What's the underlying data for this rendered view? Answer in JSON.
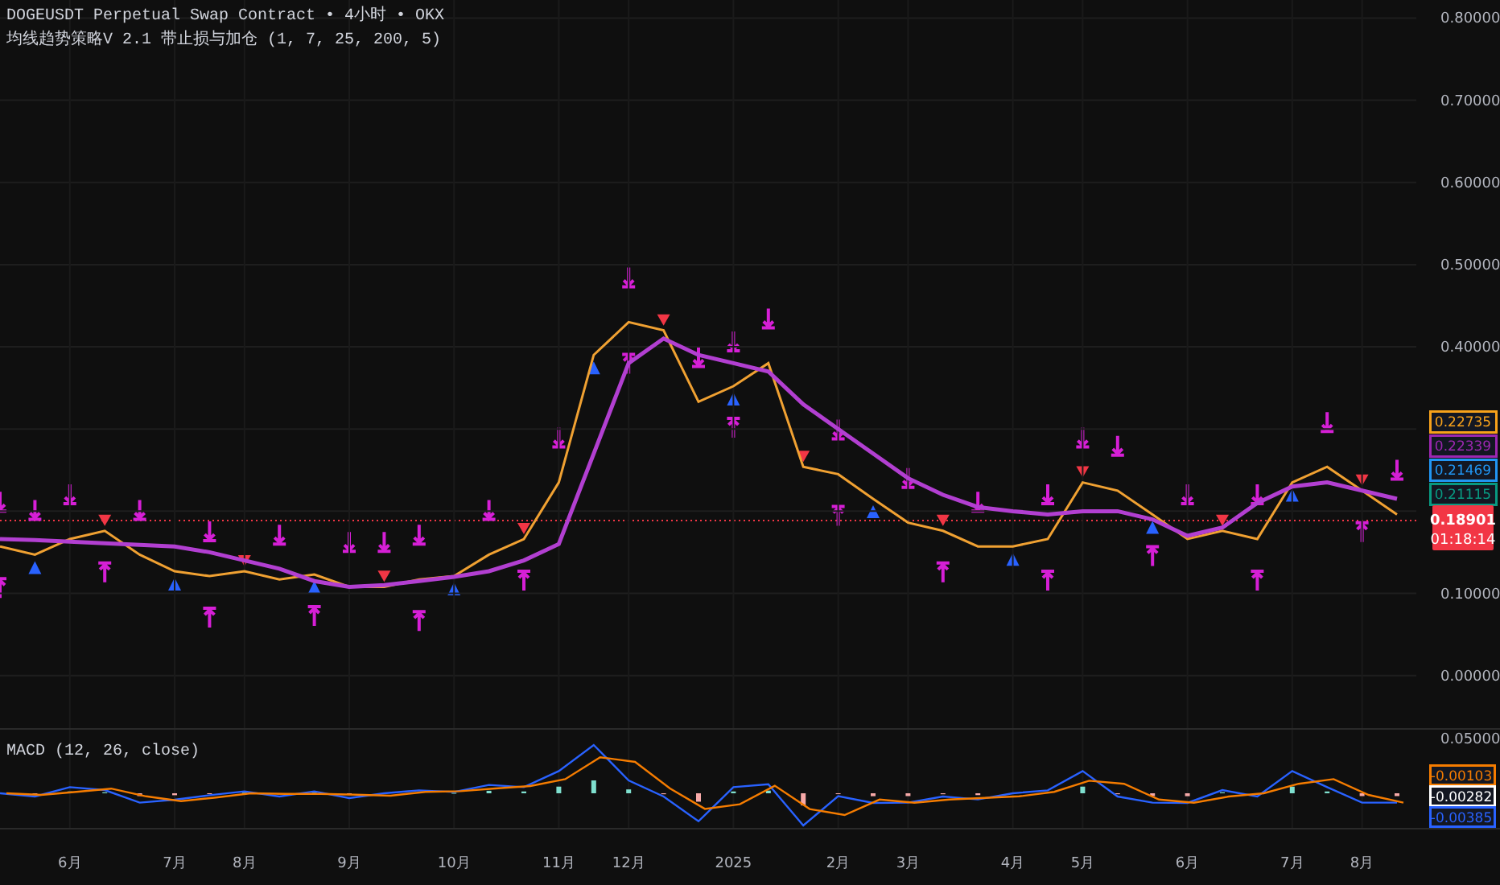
{
  "header": {
    "symbol_line": "DOGEUSDT Perpetual Swap Contract • 4小时 • OKX",
    "strategy_line": "均线趋势策略V 2.1 带止损与加仓 (1, 7, 25, 200, 5)"
  },
  "price_chart": {
    "chart_data": {
      "type": "line",
      "grid": true,
      "series": [
        {
          "color": "#f0a132",
          "values": [
            0.157,
            0.147,
            0.166,
            0.176,
            0.147,
            0.127,
            0.121,
            0.127,
            0.117,
            0.123,
            0.108,
            0.108,
            0.117,
            0.121,
            0.147,
            0.166,
            0.235,
            0.39,
            0.43,
            0.42,
            0.333,
            0.352,
            0.38,
            0.254,
            0.245,
            0.215,
            0.186,
            0.176,
            0.157,
            0.157,
            0.166,
            0.235,
            0.225,
            0.196,
            0.166,
            0.176,
            0.166,
            0.235,
            0.254,
            0.225,
            0.196
          ]
        },
        {
          "color": "#b23fd1",
          "values": [
            0.166,
            0.165,
            0.163,
            0.161,
            0.159,
            0.157,
            0.15,
            0.14,
            0.13,
            0.115,
            0.108,
            0.11,
            0.115,
            0.12,
            0.127,
            0.14,
            0.16,
            0.27,
            0.38,
            0.41,
            0.39,
            0.38,
            0.37,
            0.33,
            0.3,
            0.27,
            0.24,
            0.22,
            0.205,
            0.2,
            0.196,
            0.2,
            0.2,
            0.19,
            0.17,
            0.18,
            0.21,
            0.23,
            0.235,
            0.225,
            0.215
          ]
        }
      ],
      "ylim": [
        -0.063,
        0.822
      ],
      "categories": [
        null,
        null,
        "6月",
        null,
        null,
        "7月",
        null,
        "8月",
        null,
        null,
        "9月",
        null,
        null,
        "10月",
        null,
        null,
        "11月",
        null,
        "12月",
        null,
        null,
        "2025",
        null,
        null,
        "2月",
        null,
        "3月",
        null,
        null,
        "4月",
        null,
        "5月",
        null,
        null,
        "6月",
        null,
        null,
        "7月",
        null,
        "8月",
        null
      ],
      "yticks": [
        {
          "value": 0,
          "label": "0.00000"
        },
        {
          "value": 0.1,
          "label": "0.10000"
        },
        {
          "value": 0.4,
          "label": "0.40000"
        },
        {
          "value": 0.5,
          "label": "0.50000"
        },
        {
          "value": 0.6,
          "label": "0.60000"
        },
        {
          "value": 0.7,
          "label": "0.70000"
        },
        {
          "value": 0.8,
          "label": "0.80000"
        }
      ]
    },
    "price_tags": [
      {
        "text": "0.22735",
        "color": "#f7a21b"
      },
      {
        "text": "0.22339",
        "color": "#9c27b0"
      },
      {
        "text": "0.21469",
        "color": "#2196f3"
      },
      {
        "text": "0.21115",
        "color": "#089981"
      }
    ],
    "current_price": {
      "price": "0.18901",
      "countdown": "01:18:14"
    }
  },
  "macd": {
    "title": "MACD (12, 26, close)",
    "scale_label": "0.05000",
    "value_tags": [
      {
        "text": "-0.00103",
        "color": "#f57c00"
      },
      {
        "text": "-0.00282",
        "color": "#ffffff"
      },
      {
        "text": "-0.00385",
        "color": "#2962ff"
      }
    ]
  }
}
